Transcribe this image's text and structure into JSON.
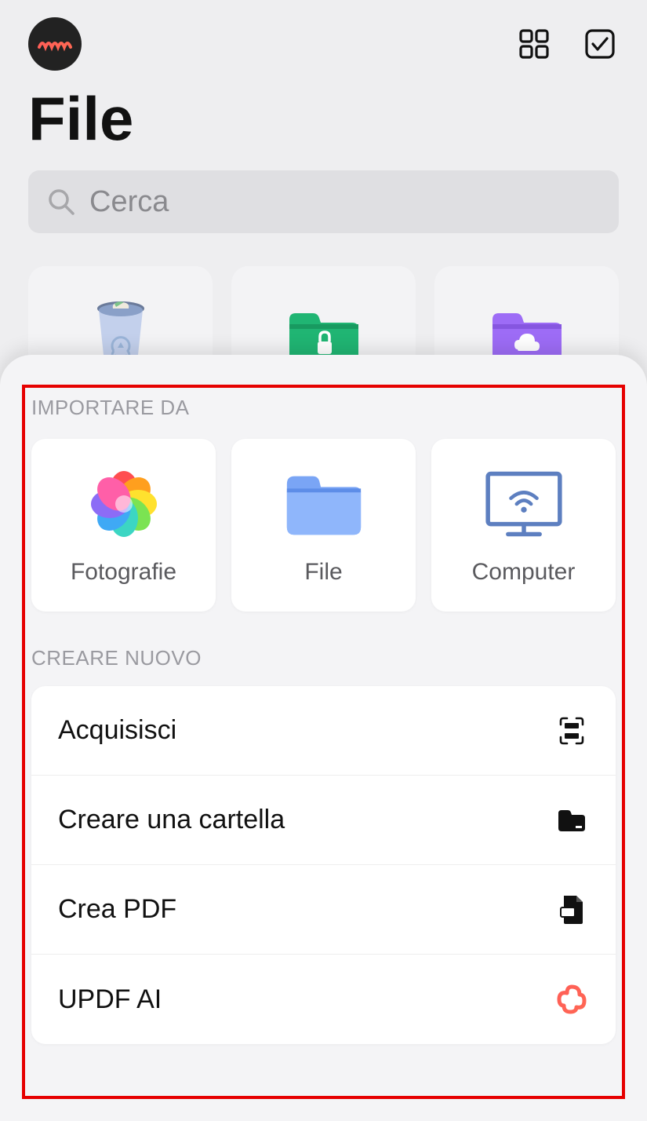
{
  "header": {
    "title": "File",
    "search_placeholder": "Cerca"
  },
  "sheet": {
    "import_label": "IMPORTARE DA",
    "import_items": [
      {
        "label": "Fotografie",
        "icon": "photos-flower-icon"
      },
      {
        "label": "File",
        "icon": "folder-icon"
      },
      {
        "label": "Computer",
        "icon": "computer-wifi-icon"
      }
    ],
    "create_label": "CREARE NUOVO",
    "create_items": [
      {
        "label": "Acquisisci",
        "icon": "scan-icon"
      },
      {
        "label": "Creare una cartella",
        "icon": "folder-solid-icon"
      },
      {
        "label": "Crea PDF",
        "icon": "pdf-doc-icon"
      },
      {
        "label": "UPDF AI",
        "icon": "updfai-icon"
      }
    ]
  }
}
